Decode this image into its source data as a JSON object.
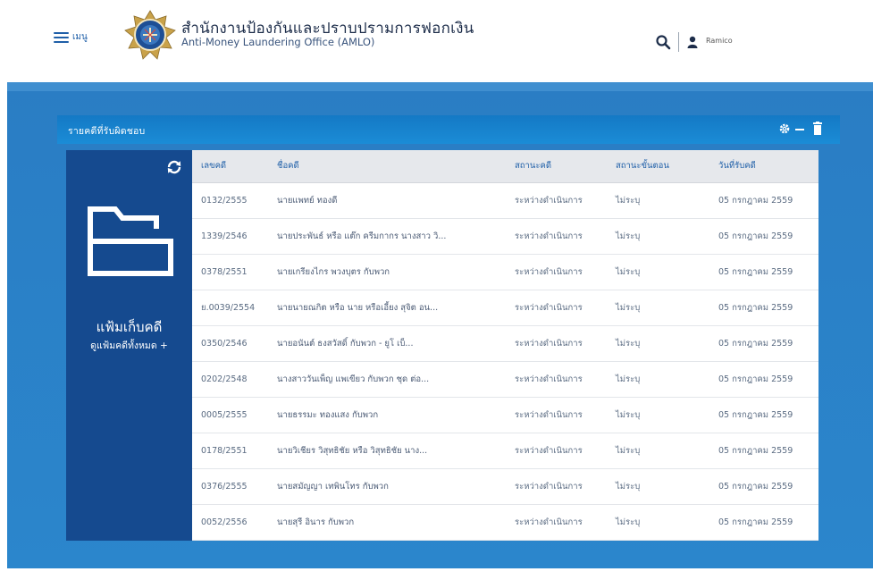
{
  "header": {
    "menu_label": "เมนู",
    "org_title_th": "สำนักงานป้องกันและปราบปรามการฟอกเงิน",
    "org_title_en": "Anti-Money Laundering Office (AMLO)",
    "user_name": "Ramico"
  },
  "panel": {
    "title": "รายคดีที่รับผิดชอบ"
  },
  "folder": {
    "title": "แฟ้มเก็บคดี",
    "link": "ดูแฟ้มคดีทั้งหมด +"
  },
  "table": {
    "columns": [
      "เลขคดี",
      "ชื่อคดี",
      "สถานะคดี",
      "สถานะขั้นตอน",
      "วันที่รับคดี"
    ],
    "rows": [
      {
        "no": "0132/2555",
        "name": "นายแพทย์ ทองดี",
        "status": "ระหว่างดำเนินการ",
        "stage": "ไม่ระบุ",
        "date": "05 กรกฎาคม 2559"
      },
      {
        "no": "1339/2546",
        "name": "นายประพันธ์ หรือ แต๊ก ครีมกากร นางสาว วิ...",
        "status": "ระหว่างดำเนินการ",
        "stage": "ไม่ระบุ",
        "date": "05 กรกฎาคม 2559"
      },
      {
        "no": "0378/2551",
        "name": "นายเกรียงไกร พวงบุตร กับพวก",
        "status": "ระหว่างดำเนินการ",
        "stage": "ไม่ระบุ",
        "date": "05 กรกฎาคม 2559"
      },
      {
        "no": "ย.0039/2554",
        "name": "นายนายณกิต หรือ นาย หรือเอี้ยง สุจิต อน...",
        "status": "ระหว่างดำเนินการ",
        "stage": "ไม่ระบุ",
        "date": "05 กรกฎาคม 2559"
      },
      {
        "no": "0350/2546",
        "name": "นายอนันต์ ธงสวัสดิ์ กับพวก - ยูโ เบ็...",
        "status": "ระหว่างดำเนินการ",
        "stage": "ไม่ระบุ",
        "date": "05 กรกฎาคม 2559"
      },
      {
        "no": "0202/2548",
        "name": "นางสาววันเพ็ญ แพเขียว กับพวก  ชุด ต่อ...",
        "status": "ระหว่างดำเนินการ",
        "stage": "ไม่ระบุ",
        "date": "05 กรกฎาคม 2559"
      },
      {
        "no": "0005/2555",
        "name": "นายธรรมะ ทองแสง กับพวก",
        "status": "ระหว่างดำเนินการ",
        "stage": "ไม่ระบุ",
        "date": "05 กรกฎาคม 2559"
      },
      {
        "no": "0178/2551",
        "name": "นายวิเชียร วิสุทธิชัย หรือ วิสุทธิชัย นาง...",
        "status": "ระหว่างดำเนินการ",
        "stage": "ไม่ระบุ",
        "date": "05 กรกฎาคม 2559"
      },
      {
        "no": "0376/2555",
        "name": "นายสมัญญา เทพินโทร กับพวก",
        "status": "ระหว่างดำเนินการ",
        "stage": "ไม่ระบุ",
        "date": "05 กรกฎาคม 2559"
      },
      {
        "no": "0052/2556",
        "name": "นายสุรี อินาร กับพวก",
        "status": "ระหว่างดำเนินการ",
        "stage": "ไม่ระบุ",
        "date": "05 กรกฎาคม 2559"
      }
    ]
  },
  "colors": {
    "header_bg": "#ffffff",
    "stage_blue": "#2a7dc4",
    "panel_bar": "#1479c5",
    "folder_panel": "#154a8f",
    "table_header": "#e6e8ec",
    "link_blue": "#1f5fa8"
  },
  "icons": {
    "menu": "hamburger-icon",
    "logo": "amlo-logo",
    "search": "search-icon",
    "user": "user-icon",
    "settings": "gear-icon",
    "minimize": "minimize-icon",
    "delete": "trash-icon",
    "refresh": "refresh-icon",
    "folder": "open-folder-icon"
  }
}
